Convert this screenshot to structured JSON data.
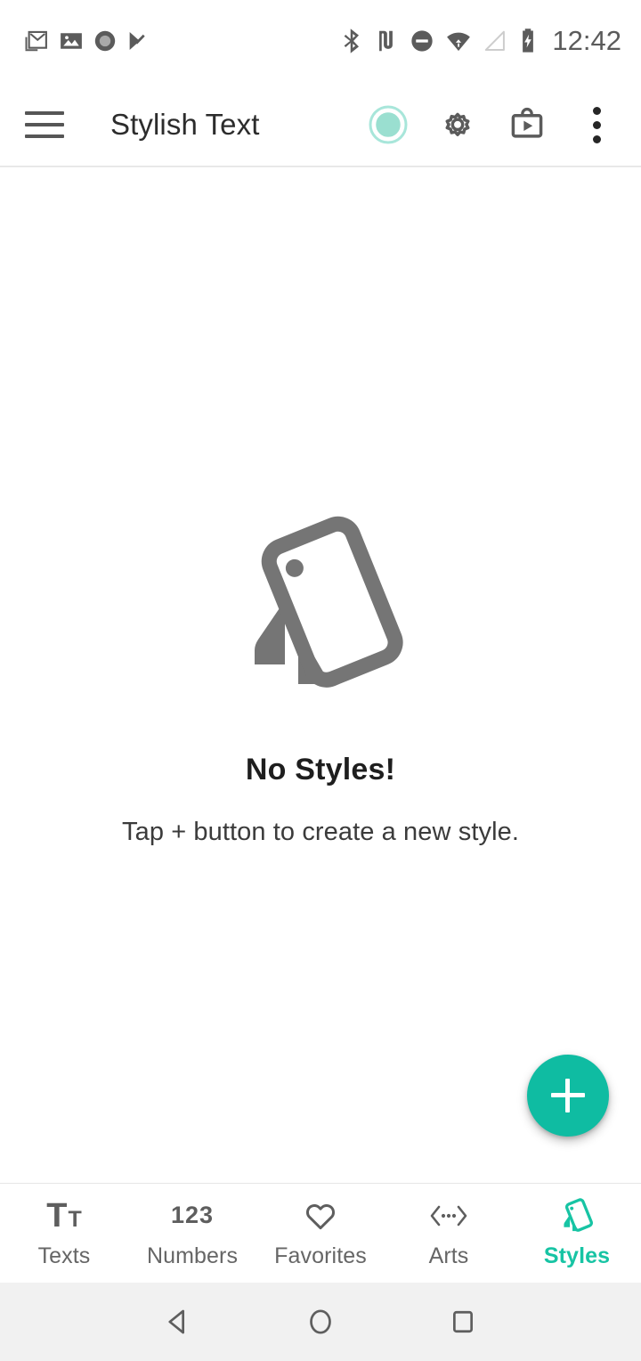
{
  "status_bar": {
    "left_icons": [
      {
        "name": "gmail-icon",
        "label": "Gmail"
      },
      {
        "name": "photos-icon",
        "label": "Photos"
      },
      {
        "name": "circle-notification-icon",
        "label": "Notification"
      },
      {
        "name": "check-flag-icon",
        "label": "Tasks"
      }
    ],
    "right_icons": [
      {
        "name": "bluetooth-icon",
        "label": "Bluetooth"
      },
      {
        "name": "nfc-icon",
        "label": "NFC"
      },
      {
        "name": "do-not-disturb-icon",
        "label": "Do Not Disturb"
      },
      {
        "name": "wifi-icon",
        "label": "Wi-Fi"
      },
      {
        "name": "cellular-signal-icon",
        "label": "Signal"
      },
      {
        "name": "battery-charging-icon",
        "label": "Battery charging"
      }
    ],
    "time": "12:42"
  },
  "toolbar": {
    "menu_label": "Menu",
    "title": "Stylish Text",
    "actions": [
      {
        "name": "service-toggle-icon",
        "label": "Service status"
      },
      {
        "name": "settings-icon",
        "label": "Settings"
      },
      {
        "name": "play-store-icon",
        "label": "More apps"
      },
      {
        "name": "overflow-menu-icon",
        "label": "More options"
      }
    ]
  },
  "content": {
    "empty_state": {
      "illustration": "tilted-phone-icon",
      "title": "No Styles!",
      "subtitle": "Tap + button to create a new style."
    },
    "fab": {
      "label": "+",
      "name": "add-style-fab"
    }
  },
  "bottom_nav": {
    "items": [
      {
        "id": "texts",
        "label": "Texts",
        "icon": "text-format-icon",
        "active": false
      },
      {
        "id": "numbers",
        "label": "Numbers",
        "icon": "numbers-icon",
        "active": false,
        "glyph": "123"
      },
      {
        "id": "favorites",
        "label": "Favorites",
        "icon": "heart-icon",
        "active": false
      },
      {
        "id": "arts",
        "label": "Arts",
        "icon": "arts-brackets-icon",
        "active": false
      },
      {
        "id": "styles",
        "label": "Styles",
        "icon": "tilted-phone-icon",
        "active": true
      }
    ]
  },
  "system_nav": {
    "buttons": [
      {
        "name": "back-button",
        "label": "Back"
      },
      {
        "name": "home-button",
        "label": "Home"
      },
      {
        "name": "recents-button",
        "label": "Recents"
      }
    ]
  },
  "colors": {
    "accent": "#0fbca2",
    "accent_active": "#17c4a4",
    "icon_gray": "#5e5e5e",
    "text_primary": "#1e1e1e",
    "text_secondary": "#666666",
    "system_nav_bg": "#f1f1f1"
  }
}
